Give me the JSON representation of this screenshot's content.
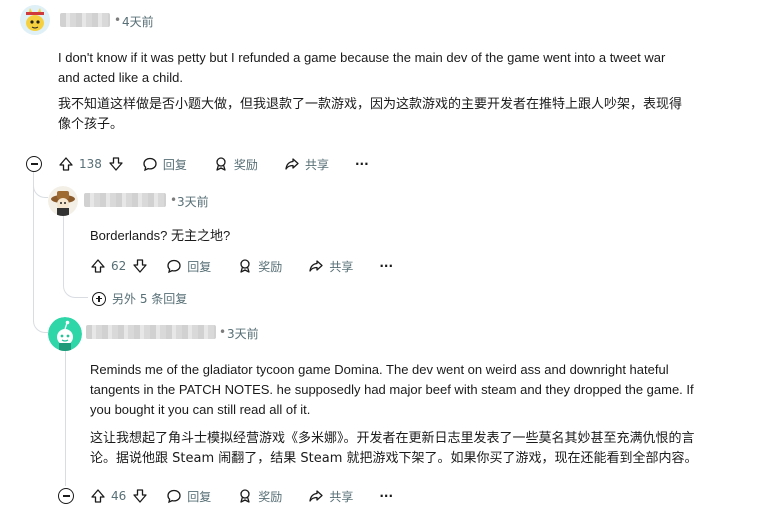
{
  "comments": [
    {
      "time": "4天前",
      "text_en": [
        "I don't know if it was petty but I refunded a game because the main dev of the game went into a tweet war",
        "and acted like a child."
      ],
      "text_cn": [
        "我不知道这样做是否小题大做，但我退款了一款游戏，因为这款游戏的主要开发者在推特上跟人吵架，表现得",
        "像个孩子。"
      ],
      "votes": "138",
      "actions": {
        "reply": "回复",
        "award": "奖励",
        "share": "共享",
        "more": "···"
      }
    },
    {
      "time": "3天前",
      "text_en": [
        "Borderlands?  无主之地?"
      ],
      "votes": "62",
      "actions": {
        "reply": "回复",
        "award": "奖励",
        "share": "共享",
        "more": "···"
      },
      "more_replies": "另外 5 条回复"
    },
    {
      "time": "3天前",
      "text_en": [
        "Reminds me of the gladiator tycoon game Domina. The dev went on weird ass and downright hateful",
        "tangents in the PATCH NOTES. he supposedly had major beef with steam and they dropped the game. If",
        "you bought it you can still read all of it."
      ],
      "text_cn": [
        "这让我想起了角斗士模拟经营游戏《多米娜》。开发者在更新日志里发表了一些莫名其妙甚至充满仇恨的言",
        "论。据说他跟 Steam 闹翻了，结果 Steam 就把游戏下架了。如果你买了游戏，现在还能看到全部内容。"
      ],
      "votes": "46",
      "actions": {
        "reply": "回复",
        "award": "奖励",
        "share": "共享",
        "more": "···"
      }
    }
  ],
  "separator": "•",
  "icons": [
    "upvote-icon",
    "downvote-icon",
    "reply-icon",
    "award-icon",
    "share-icon",
    "collapse-icon",
    "expand-icon"
  ]
}
